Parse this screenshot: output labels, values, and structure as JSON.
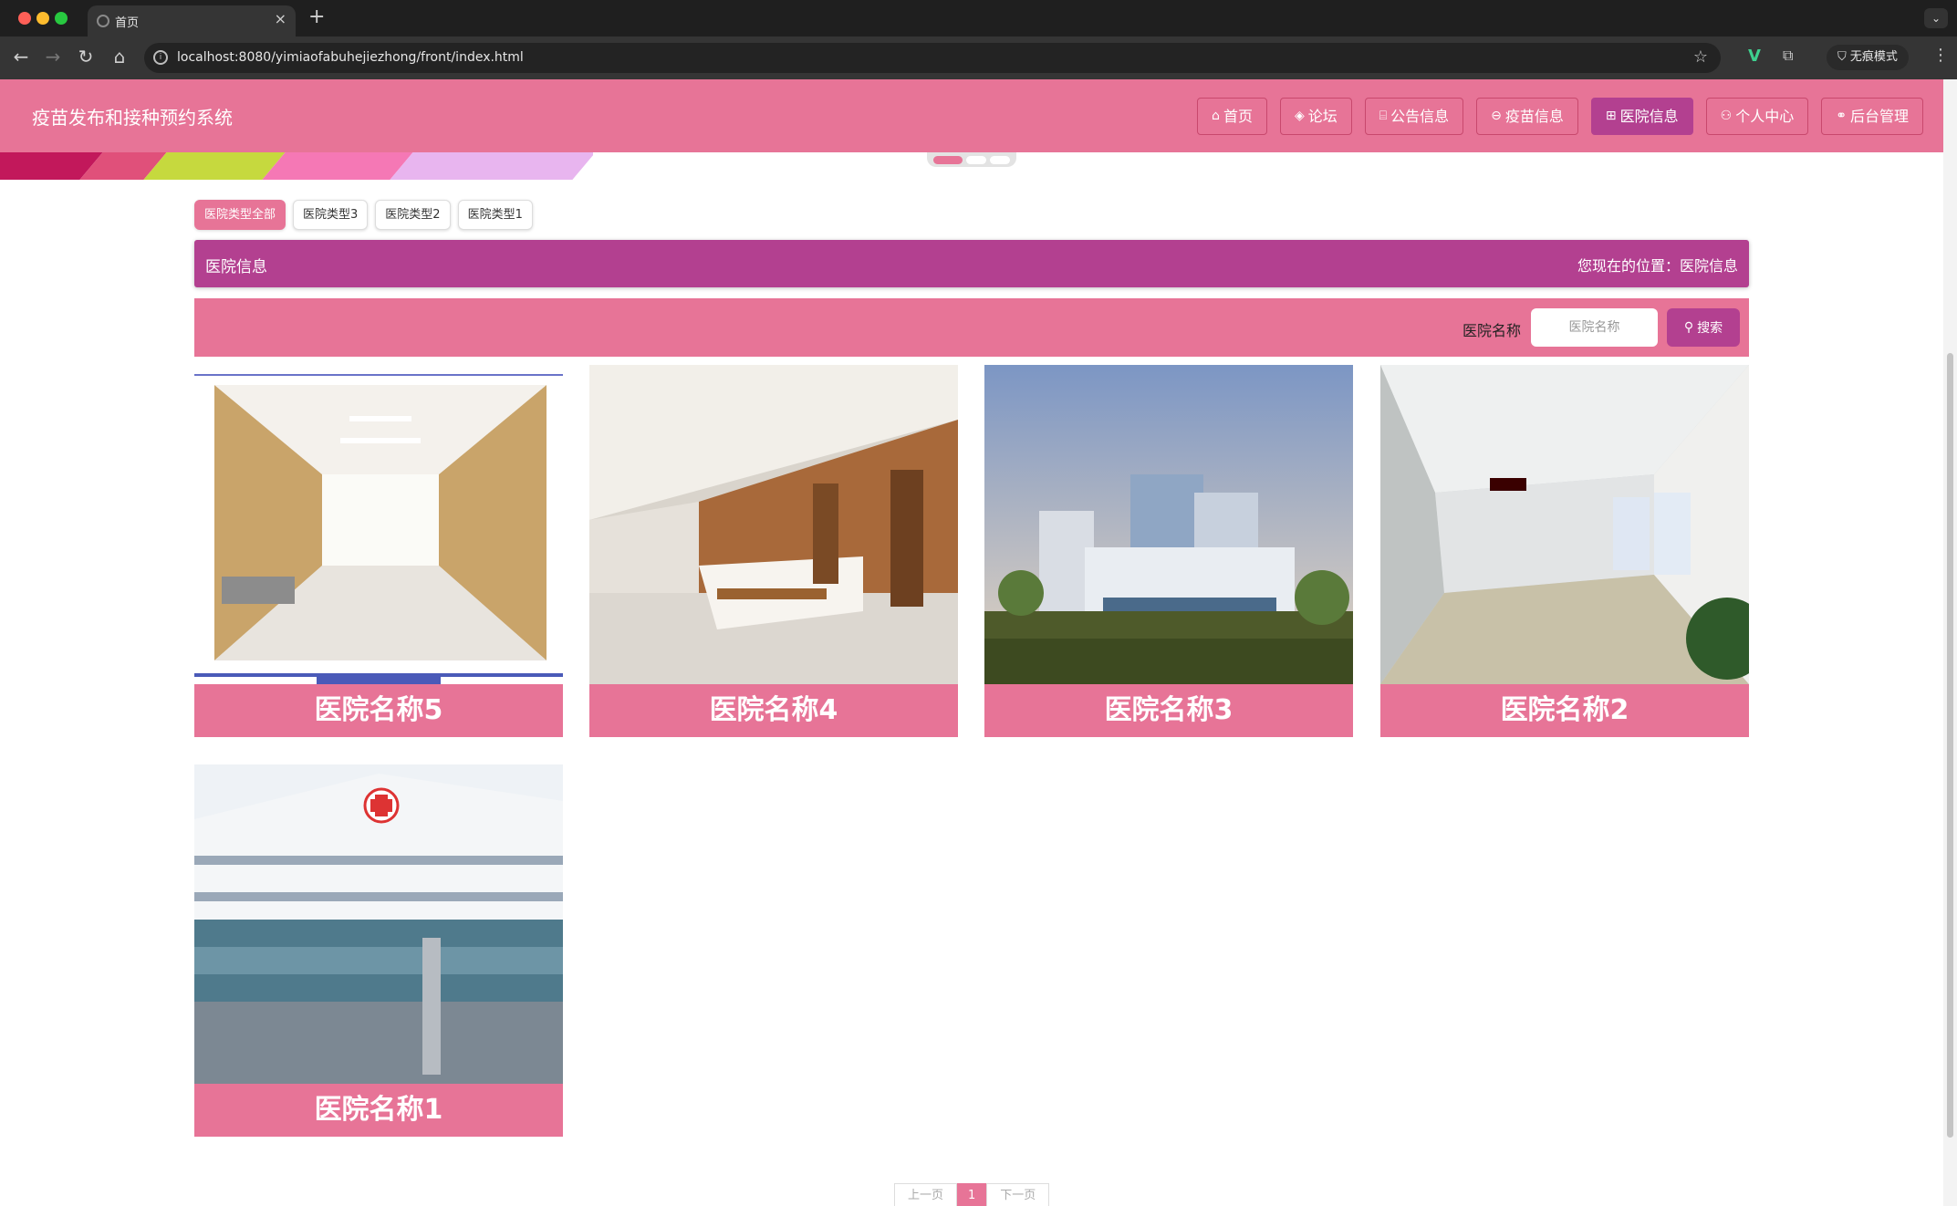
{
  "browser": {
    "tab_title": "首页",
    "url": "localhost:8080/yimiaofabuhejiezhong/front/index.html",
    "incognito_label": "无痕模式"
  },
  "header": {
    "site_title": "疫苗发布和接种预约系统",
    "nav": [
      {
        "label": "首页",
        "icon": "home-icon"
      },
      {
        "label": "论坛",
        "icon": "forum-icon"
      },
      {
        "label": "公告信息",
        "icon": "notice-icon"
      },
      {
        "label": "疫苗信息",
        "icon": "vaccine-icon"
      },
      {
        "label": "医院信息",
        "icon": "hospital-icon",
        "active": true
      },
      {
        "label": "个人中心",
        "icon": "user-icon"
      },
      {
        "label": "后台管理",
        "icon": "link-icon"
      }
    ]
  },
  "type_tabs": [
    "医院类型全部",
    "医院类型3",
    "医院类型2",
    "医院类型1"
  ],
  "location_bar": {
    "title": "医院信息",
    "path": "您现在的位置：医院信息"
  },
  "search": {
    "label": "医院名称",
    "placeholder": "医院名称",
    "button_label": "搜索"
  },
  "hospitals": [
    {
      "name": "医院名称5"
    },
    {
      "name": "医院名称4"
    },
    {
      "name": "医院名称3"
    },
    {
      "name": "医院名称2"
    },
    {
      "name": "医院名称1"
    }
  ],
  "pagination": {
    "prev": "上一页",
    "current": "1",
    "next": "下一页"
  },
  "colors": {
    "header_pink": "#e77497",
    "accent_purple": "#b34090"
  }
}
